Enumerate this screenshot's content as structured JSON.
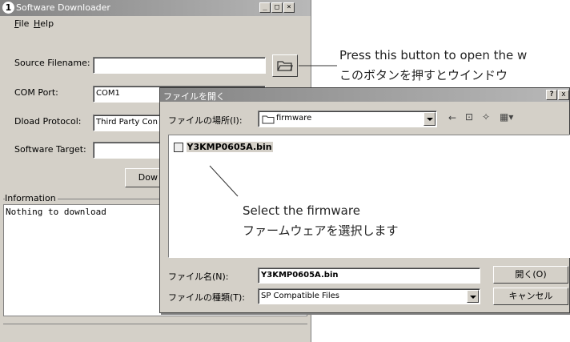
{
  "main_window": {
    "title": "Software Downloader",
    "app_icon_text": "1",
    "title_buttons": [
      "_",
      "□",
      "×"
    ],
    "menu": [
      {
        "label": "File",
        "key": "F"
      },
      {
        "label": "Help",
        "key": "H"
      }
    ],
    "source_filename": {
      "label": "Source Filename:",
      "value": ""
    },
    "com_port": {
      "label": "COM Port:",
      "value": "COM1"
    },
    "dload_protocol": {
      "label": "Dload Protocol:",
      "value": "Third Party Con"
    },
    "software_target": {
      "label": "Software Target:",
      "value": ""
    },
    "download_button": "Dow",
    "information": {
      "label": "Information",
      "text": "Nothing to download"
    }
  },
  "dialog": {
    "title": "ファイルを開く",
    "help_button": "?",
    "close_button": "x",
    "look_in_label": "ファイルの場所(I):",
    "look_in_value": "firmware",
    "files": [
      "Y3KMP0605A.bin"
    ],
    "filename_label": "ファイル名(N):",
    "filename_value": "Y3KMP0605A.bin",
    "filetype_label": "ファイルの種類(T):",
    "filetype_value": "SP Compatible Files",
    "open_button": "開く(O)",
    "cancel_button": "キャンセル"
  },
  "annotations": {
    "open_button_en": "Press this button to open the w",
    "open_button_ja": "このボタンを押すとウインドウ",
    "select_en": "Select the firmware",
    "select_ja": "ファームウェアを選択します"
  }
}
